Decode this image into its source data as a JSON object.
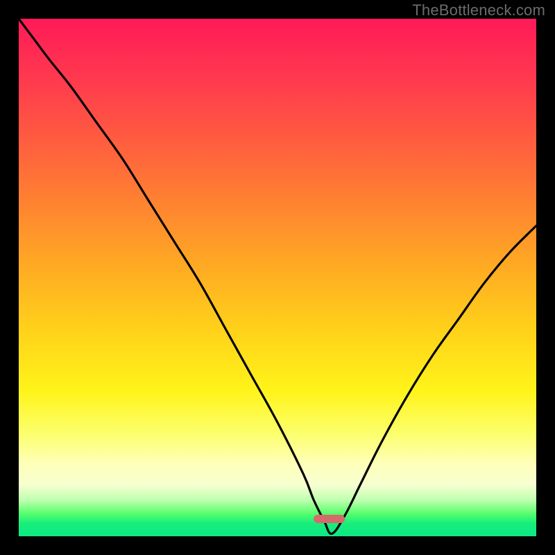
{
  "watermark": "TheBottleneck.com",
  "colors": {
    "frame": "#000000",
    "curve": "#000000",
    "marker": "#d56a6a"
  },
  "chart_data": {
    "type": "line",
    "title": "",
    "xlabel": "",
    "ylabel": "",
    "xlim": [
      0,
      100
    ],
    "ylim": [
      0,
      100
    ],
    "grid": false,
    "legend": false,
    "series": [
      {
        "name": "bottleneck-curve",
        "x": [
          0,
          3,
          6,
          10,
          15,
          20,
          25,
          30,
          35,
          40,
          45,
          50,
          55,
          57,
          59,
          60.5,
          63,
          66,
          70,
          75,
          80,
          85,
          90,
          95,
          100
        ],
        "y": [
          100,
          96,
          92,
          87,
          80,
          73,
          65,
          57,
          49,
          40,
          31,
          22,
          12,
          7,
          3,
          0.5,
          4,
          10,
          18,
          27,
          35,
          42,
          49,
          55,
          60
        ]
      }
    ],
    "marker": {
      "x_center": 60,
      "width_pct": 6,
      "height_pct": 1.6
    }
  }
}
